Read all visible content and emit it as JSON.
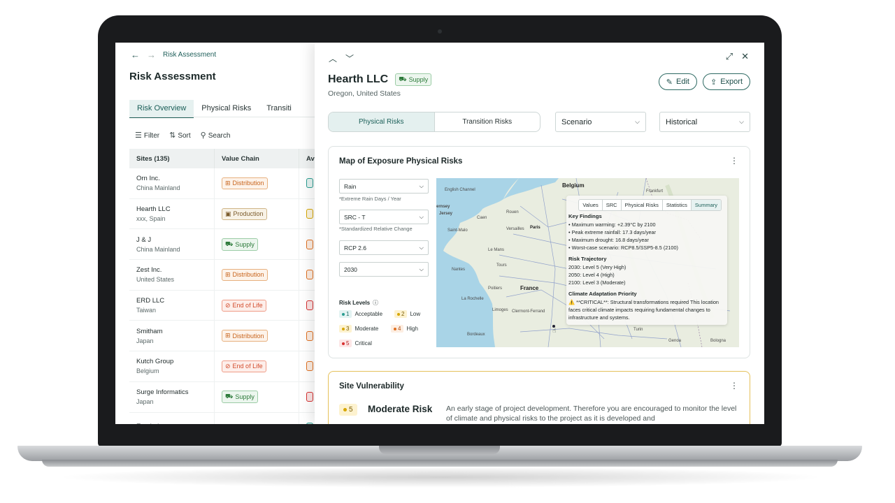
{
  "breadcrumb": {
    "back": "←",
    "forward": "→",
    "current": "Risk Assessment"
  },
  "page_title": "Risk Assessment",
  "tabs": [
    "Risk Overview",
    "Physical Risks",
    "Transiti"
  ],
  "toolbar": {
    "filter": "Filter",
    "sort": "Sort",
    "search": "Search"
  },
  "table": {
    "headers": [
      "Sites (135)",
      "Value Chain",
      "Av"
    ],
    "rows": [
      {
        "name": "Orn Inc.",
        "location": "China Mainland",
        "tag": "Distribution",
        "tag_type": "dist",
        "level_color": "#2a9d91"
      },
      {
        "name": "Hearth LLC",
        "location": "xxx, Spain",
        "tag": "Production",
        "tag_type": "prod",
        "level_color": "#d7a600"
      },
      {
        "name": "J & J",
        "location": "China Mainland",
        "tag": "Supply",
        "tag_type": "supply",
        "level_color": "#e07020"
      },
      {
        "name": "Zest Inc.",
        "location": "United States",
        "tag": "Distribution",
        "tag_type": "dist",
        "level_color": "#e07020"
      },
      {
        "name": "ERD LLC",
        "location": "Taiwan",
        "tag": "End of Life",
        "tag_type": "eol",
        "level_color": "#d73030"
      },
      {
        "name": "Smitham",
        "location": "Japan",
        "tag": "Distribution",
        "tag_type": "dist",
        "level_color": "#e07020"
      },
      {
        "name": "Kutch Group",
        "location": "Belgium",
        "tag": "End of Life",
        "tag_type": "eol",
        "level_color": "#e07020"
      },
      {
        "name": "Surge Informatics",
        "location": "Japan",
        "tag": "Supply",
        "tag_type": "supply",
        "level_color": "#d73030"
      },
      {
        "name": "Enn Labs",
        "location": "",
        "tag": "",
        "tag_type": "prod",
        "level_color": "#2a9d91"
      }
    ]
  },
  "panel": {
    "company": "Hearth LLC",
    "company_tag": "Supply",
    "location": "Oregon, United States",
    "edit_label": "Edit",
    "export_label": "Export",
    "segments": [
      "Physical Risks",
      "Transition Risks"
    ],
    "scenario_label": "Scenario",
    "period_label": "Historical"
  },
  "map_card": {
    "title": "Map of Exposure Physical Risks",
    "hazard": "Rain",
    "hazard_note": "*Extreme Rain Days / Year",
    "metric": "SRC - T",
    "metric_note": "*Standardized Relative Change",
    "scenario": "RCP 2.6",
    "year": "2030",
    "legend_title": "Risk Levels",
    "legend": [
      {
        "num": "1",
        "label": "Acceptable"
      },
      {
        "num": "2",
        "label": "Low"
      },
      {
        "num": "3",
        "label": "Moderate"
      },
      {
        "num": "4",
        "label": "High"
      },
      {
        "num": "5",
        "label": "Critical"
      }
    ],
    "map_labels": {
      "belgium": "Belgium",
      "france": "France",
      "paris": "Paris",
      "nantes": "Nantes",
      "jersey": "Jersey",
      "ernsey": "ernsey",
      "rouen": "Rouen",
      "le_mans": "Le Mans",
      "tours": "Tours",
      "poitiers": "Poitiers",
      "bordeaux": "Bordeaux",
      "turin": "Turin",
      "bologna": "Bologna",
      "frankfurt": "Frankfurt",
      "versailles": "Versailles",
      "saint_malo": "Saint-Malo",
      "caen": "Caen",
      "la_rochelle": "La Rochelle",
      "clermont": "Clermont-Ferrand",
      "limoges": "Limoges",
      "genoa": "Genoa",
      "english_channel": "English Channel"
    },
    "popup": {
      "tabs": [
        "Values",
        "SRC",
        "Physical Risks",
        "Statistics",
        "Summary"
      ],
      "key_findings_title": "Key Findings",
      "key_findings": [
        "• Maximum warming: +2.39°C by 2100",
        "• Peak extreme rainfall: 17.3 days/year",
        "• Maximum drought: 16.8 days/year",
        "• Worst-case scenario: RCP8.5/SSP5-8.5 (2100)"
      ],
      "trajectory_title": "Risk Trajectory",
      "trajectory": [
        "2030: Level 5 (Very High)",
        "2050: Level 4 (High)",
        "2100: Level 3 (Moderate)"
      ],
      "priority_title": "Climate Adaptation Priority",
      "priority_text": "⚠️ **CRITICAL**: Structural transformations required This location faces critical climate impacts requiring fundamental changes to infrastructure and systems."
    }
  },
  "vuln_card": {
    "title": "Site Vulnerability",
    "level": "5",
    "label": "Moderate Risk",
    "description": "An early stage of project development. Therefore you are encouraged to monitor the level of climate and physical risks to the project as it is developed and"
  }
}
